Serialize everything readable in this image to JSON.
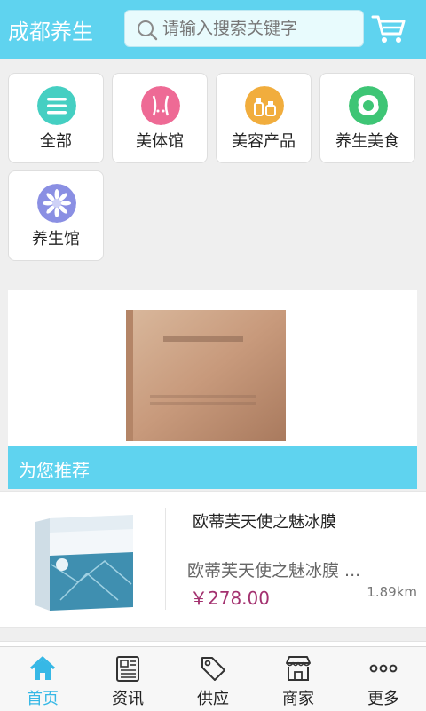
{
  "header": {
    "title": "成都养生",
    "search_placeholder": "请输入搜索关键字"
  },
  "categories": [
    {
      "label": "全部",
      "icon": "list-icon",
      "color": "#45cfc2"
    },
    {
      "label": "美体馆",
      "icon": "body-icon",
      "color": "#ee6a95"
    },
    {
      "label": "美容产品",
      "icon": "cosmetics-icon",
      "color": "#f1ad3d"
    },
    {
      "label": "养生美食",
      "icon": "food-icon",
      "color": "#3ec575"
    },
    {
      "label": "养生馆",
      "icon": "flower-icon",
      "color": "#8a8fe3"
    }
  ],
  "recommend": {
    "title": "为您推荐"
  },
  "products": [
    {
      "name": "欧蒂芙天使之魅冰膜",
      "desc": "欧蒂芙天使之魅冰膜 ...",
      "price": "￥278.00",
      "distance": "1.89km"
    }
  ],
  "tabs": [
    {
      "label": "首页",
      "icon": "home-icon",
      "active": true
    },
    {
      "label": "资讯",
      "icon": "news-icon"
    },
    {
      "label": "供应",
      "icon": "tag-icon"
    },
    {
      "label": "商家",
      "icon": "shop-icon"
    },
    {
      "label": "更多",
      "icon": "more-icon"
    }
  ],
  "colors": {
    "accent": "#5fd3ef",
    "price": "#a3316f",
    "active_tab": "#36b8e6"
  }
}
